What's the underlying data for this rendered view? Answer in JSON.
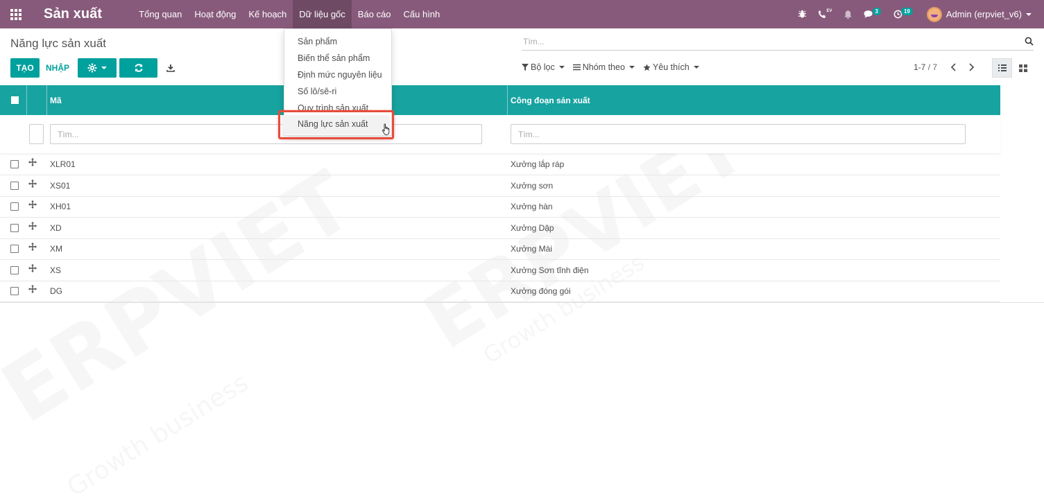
{
  "app": {
    "title": "Sản xuất",
    "menu": [
      "Tổng quan",
      "Hoạt động",
      "Kế hoạch",
      "Dữ liệu gốc",
      "Báo cáo",
      "Cấu hình"
    ],
    "open_menu_index": 3,
    "accent_color": "#875a7b",
    "teal_color": "#00a09d"
  },
  "systray": {
    "ev_label": "EV",
    "messages_count": "3",
    "activities_count": "19",
    "user_label": "Admin (erpviet_v6)"
  },
  "control_panel": {
    "page_title": "Năng lực sản xuất",
    "create_label": "TẠO",
    "import_label": "NHẬP",
    "search_placeholder": "Tìm...",
    "filter_label": "Bộ lọc",
    "groupby_label": "Nhóm theo",
    "favorites_label": "Yêu thích",
    "pager_value": "1-7",
    "pager_total": "/ 7"
  },
  "dropdown": {
    "items": [
      "Sản phẩm",
      "Biến thể sản phẩm",
      "Định mức nguyên liệu",
      "Số lô/sê-ri",
      "Quy trình sản xuất",
      "Năng lực sản xuất"
    ],
    "highlighted_index": 5
  },
  "table": {
    "columns": [
      "Mã",
      "Công đoạn sản xuất"
    ],
    "filter_placeholder": "Tìm...",
    "rows": [
      {
        "code": "XLR01",
        "stage": "Xưởng lắp ráp"
      },
      {
        "code": "XS01",
        "stage": "Xưởng sơn"
      },
      {
        "code": "XH01",
        "stage": "Xưởng hàn"
      },
      {
        "code": "XD",
        "stage": "Xưởng Dập"
      },
      {
        "code": "XM",
        "stage": "Xưởng Mài"
      },
      {
        "code": "XS",
        "stage": "Xưởng Sơn tĩnh điện"
      },
      {
        "code": "DG",
        "stage": "Xưởng đóng gói"
      }
    ]
  },
  "watermark": {
    "brand": "ERPVIET",
    "tagline": "Growth business"
  }
}
